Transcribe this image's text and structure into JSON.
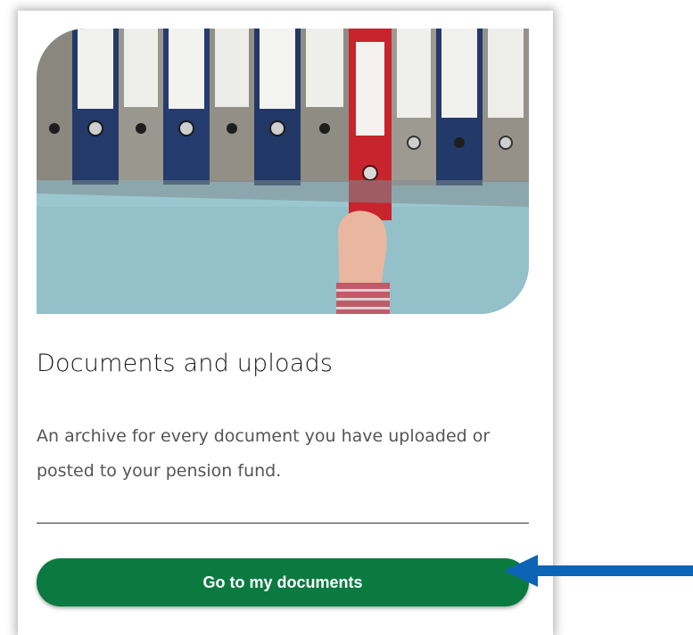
{
  "card": {
    "image_alt": "Row of binders with a hand pulling out a red binder",
    "title": "Documents and uploads",
    "description": "An archive for every document you have uploaded or posted to your pension fund.",
    "button_label": "Go to my documents"
  },
  "colors": {
    "button": "#0b7a41",
    "arrow": "#0b64b5",
    "background_wall": "#9bc7d0",
    "accent_binder": "#c8242d"
  },
  "annotations": {
    "arrow_icon": "arrow-left-icon"
  }
}
